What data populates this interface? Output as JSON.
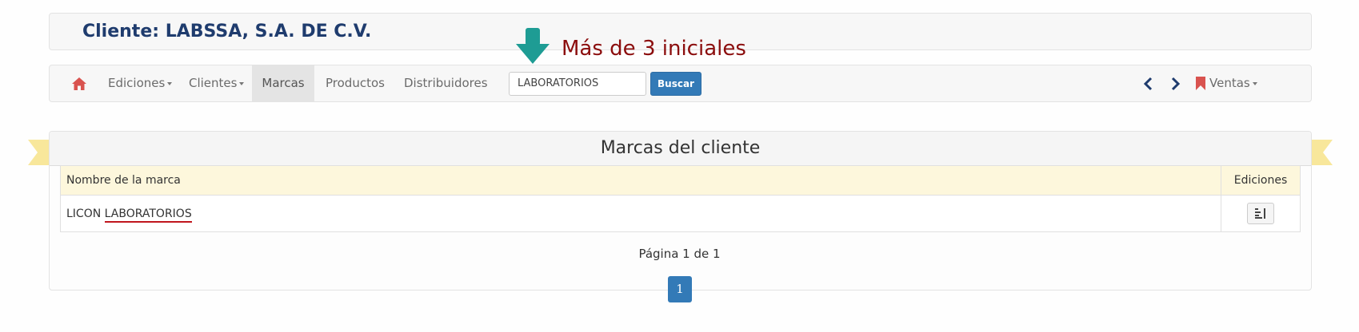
{
  "client": {
    "title": "Cliente: LABSSA, S.A. DE C.V."
  },
  "navbar": {
    "items": [
      {
        "label": "Ediciones",
        "dropdown": true
      },
      {
        "label": "Clientes",
        "dropdown": true
      },
      {
        "label": "Marcas",
        "active": true
      },
      {
        "label": "Productos"
      },
      {
        "label": "Distribuidores"
      }
    ],
    "search": {
      "value": "LABORATORIOS",
      "button_label": "Buscar"
    },
    "ventas_label": "Ventas"
  },
  "annotation": {
    "hint": "Más de 3 iniciales",
    "arrow_color": "#1e9c94"
  },
  "brands": {
    "title": "Marcas del cliente",
    "columns": [
      "Nombre de la marca",
      "Ediciones"
    ],
    "rows": [
      {
        "prefix": "LICON",
        "match": "LABORATORIOS"
      }
    ]
  },
  "pagination": {
    "info": "Página 1 de 1",
    "current": "1"
  },
  "colors": {
    "primary": "#337ab7",
    "home_icon": "#d9534f",
    "client_title": "#1f3c6e",
    "hint": "#8b0d0d",
    "highlight_underline": "#c0161d",
    "table_header": "#fdf7dc",
    "ribbon": "#f8e79b"
  },
  "icons": [
    "home-icon",
    "chevron-left-icon",
    "chevron-right-icon",
    "bookmark-icon",
    "down-arrow-icon",
    "list-icon"
  ]
}
